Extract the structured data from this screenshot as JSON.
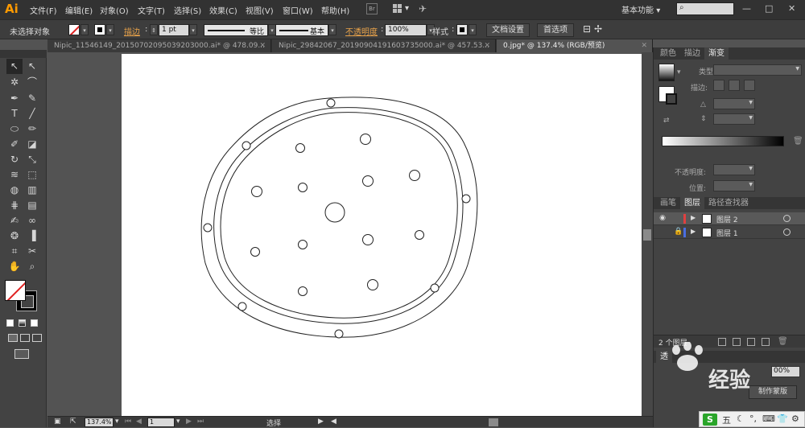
{
  "app": {
    "logo": "Ai"
  },
  "menu": {
    "items": [
      "文件(F)",
      "编辑(E)",
      "对象(O)",
      "文字(T)",
      "选择(S)",
      "效果(C)",
      "视图(V)",
      "窗口(W)",
      "帮助(H)"
    ],
    "bridge_label": "Br",
    "workspace": "基本功能",
    "workspace_arrow": "▾",
    "search_icon_glyph": "⌕",
    "min": "—",
    "restore": "□",
    "close": "✕"
  },
  "control": {
    "selection_status": "未选择对象",
    "stroke_label": "描边",
    "stroke_weight": "1 pt",
    "profile_uniform": "等比",
    "profile_basic": "基本",
    "opacity_label": "不透明度",
    "opacity_value": "100%",
    "style_label": "样式",
    "doc_setup_button": "文档设置",
    "preferences_button": "首选项",
    "dropdown_glyph": "▾",
    "spinner_glyph": "⇕"
  },
  "tabs": [
    {
      "label": "Nipic_11546149_20150702095039203000.ai* @ 478.09...",
      "close": "✕"
    },
    {
      "label": "Nipic_29842067_20190904191603735000.ai* @ 457.53...",
      "close": "✕"
    },
    {
      "label": "0.jpg* @ 137.4% (RGB/预览)",
      "close": "✕"
    }
  ],
  "tools": {
    "selection": "↖",
    "direct_selection": "↖",
    "magic_wand": "✲",
    "lasso": "⌒",
    "pen": "✒",
    "curvature": "✎",
    "type": "T",
    "line": "╱",
    "ellipse": "⬭",
    "paintbrush": "✏",
    "pencil": "✐",
    "eraser": "◪",
    "rotate": "↻",
    "scale": "⤡",
    "warp": "≋",
    "free_transform": "⬚",
    "shape_builder": "◍",
    "perspective": "▥",
    "mesh": "⋕",
    "gradient": "▤",
    "eyedropper": "✍",
    "blend": "∞",
    "symbol_sprayer": "❂",
    "column_graph": "▐",
    "artboard": "⌗",
    "slice": "✂",
    "hand": "✋",
    "zoom": "⌕"
  },
  "gradient_panel": {
    "tabs": [
      "颜色",
      "描边",
      "渐变"
    ],
    "type_label": "类型",
    "stroke_label": "描边",
    "opacity_label": "不透明度",
    "location_label": "位置"
  },
  "layers_panel": {
    "tabs": [
      "画笔",
      "图层",
      "路径查找器"
    ],
    "layers": [
      {
        "name": "图层 2",
        "color": "#e04040",
        "selected": true,
        "visible": true,
        "locked": false
      },
      {
        "name": "图层 1",
        "color": "#4a6ee0",
        "selected": false,
        "visible": false,
        "locked": true
      }
    ],
    "count": "2 个图层",
    "eye_glyph": "◉",
    "lock_glyph": "🔒",
    "arrow_glyph": "▶"
  },
  "lower_panel": {
    "tab": "透",
    "percent": "00%",
    "button": "制作蒙版"
  },
  "status": {
    "zoom": "137.4%",
    "artboard": "1",
    "mode": "选择"
  },
  "watermark": "经验",
  "tray": {
    "ime": "S",
    "items": [
      "五",
      "☾",
      "°,",
      "⌨",
      "👕",
      "⚙"
    ]
  },
  "colors": {
    "accent_orange": "#ff9a00",
    "layer2_red": "#e04040",
    "layer1_blue": "#4a6ee0",
    "no_fill_red": "#e02020"
  }
}
